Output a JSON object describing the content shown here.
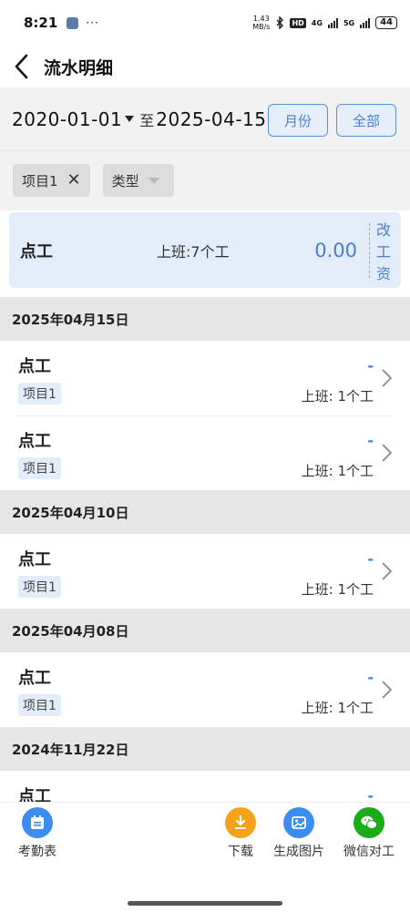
{
  "status": {
    "time": "8:21",
    "dots": "···",
    "speed_top": "1.43",
    "speed_bottom": "MB/s",
    "hd": "HD",
    "net1": "4G",
    "net2": "5G",
    "battery": "44"
  },
  "header": {
    "title": "流水明细"
  },
  "filter": {
    "start_date": "2020-01-01",
    "to_label": "至",
    "end_date": "2025-04-15",
    "month_button": "月份",
    "all_button": "全部",
    "project_chip": "项目1",
    "type_chip": "类型"
  },
  "summary": {
    "type": "点工",
    "work": "上班:7个工",
    "amount": "0.00",
    "adjust": [
      "改",
      "工",
      "资"
    ]
  },
  "groups": [
    {
      "date": "2025年04月15日",
      "entries": [
        {
          "type": "点工",
          "tag": "项目1",
          "amount": "-",
          "work": "上班: 1个工"
        },
        {
          "type": "点工",
          "tag": "项目1",
          "amount": "-",
          "work": "上班: 1个工"
        }
      ]
    },
    {
      "date": "2025年04月10日",
      "entries": [
        {
          "type": "点工",
          "tag": "项目1",
          "amount": "-",
          "work": "上班: 1个工"
        }
      ]
    },
    {
      "date": "2025年04月08日",
      "entries": [
        {
          "type": "点工",
          "tag": "项目1",
          "amount": "-",
          "work": "上班: 1个工"
        }
      ]
    },
    {
      "date": "2024年11月22日",
      "entries": [
        {
          "type": "点工",
          "tag": "",
          "amount": "-",
          "work": ""
        }
      ]
    }
  ],
  "bottom_nav": {
    "attendance": "考勤表",
    "download": "下载",
    "gen_image": "生成图片",
    "wechat": "微信对工"
  },
  "colors": {
    "accent": "#4a7fcf",
    "summary_bg": "#e3ecf9",
    "download": "#f5a21b",
    "gen_image": "#3b8ef0",
    "wechat": "#1aad19",
    "attendance": "#3b8ef0"
  }
}
